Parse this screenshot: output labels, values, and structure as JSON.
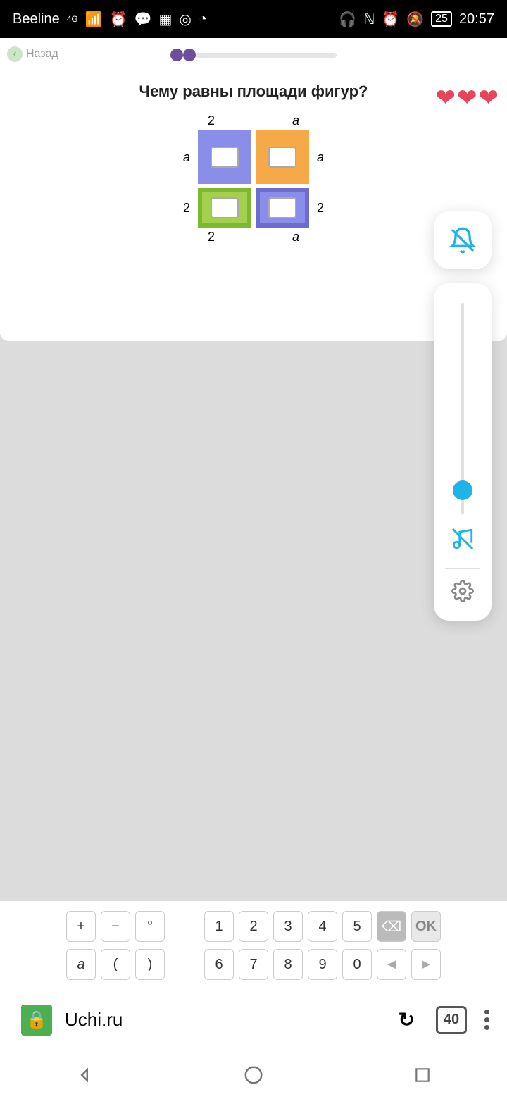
{
  "status": {
    "carrier": "Beeline",
    "net": "4G",
    "battery": "25",
    "time": "20:57"
  },
  "nav": {
    "back": "Назад"
  },
  "question": "Чему равны площади фигур?",
  "dims": {
    "top_left": "2",
    "top_right": "a",
    "left_top": "a",
    "right_top": "a",
    "left_bot": "2",
    "right_bot": "2",
    "bot_left": "2",
    "bot_right": "a"
  },
  "hearts": 3,
  "keyboard": {
    "row1": [
      "+",
      "−",
      "°",
      "1",
      "2",
      "3",
      "4",
      "5"
    ],
    "bksp": "⌫",
    "ok": "OK",
    "row2": [
      "a",
      "(",
      ")",
      "6",
      "7",
      "8",
      "9",
      "0"
    ],
    "left": "◄",
    "right": "►"
  },
  "browser": {
    "url": "Uchi.ru",
    "tabs": "40"
  }
}
